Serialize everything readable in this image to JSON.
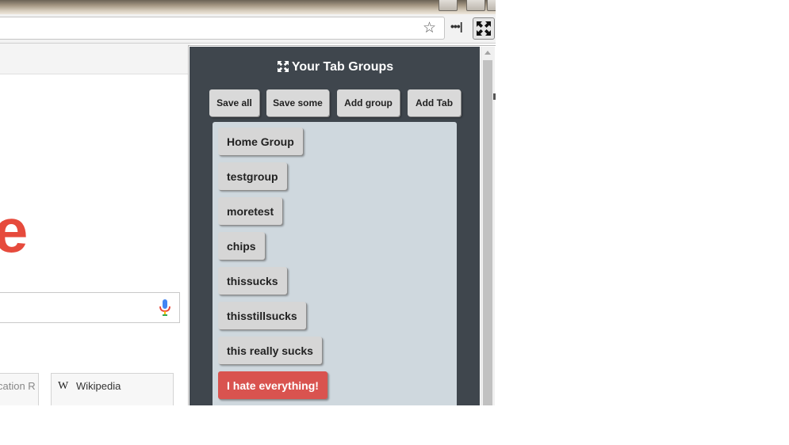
{
  "browser": {
    "toolbar": {
      "star_icon": "star-icon",
      "more_icon": "overflow-menu-icon",
      "more_glyph": "•••|",
      "extension_icon": "expand-arrows-icon"
    }
  },
  "page": {
    "logo_letter": "e",
    "tiles": [
      {
        "label": "cation R"
      },
      {
        "label": "Wikipedia",
        "icon_glyph": "W"
      }
    ]
  },
  "popup": {
    "title": "Your Tab Groups",
    "actions": {
      "save_all": "Save all",
      "save_some": "Save some",
      "add_group": "Add group",
      "add_tab": "Add Tab"
    },
    "groups": [
      {
        "label": "Home Group"
      },
      {
        "label": "testgroup"
      },
      {
        "label": "moretest"
      },
      {
        "label": "chips"
      },
      {
        "label": "thissucks"
      },
      {
        "label": "thisstillsucks"
      },
      {
        "label": "this really sucks"
      },
      {
        "label": "I hate everything!",
        "highlighted": true
      }
    ],
    "colors": {
      "background": "#3f464d",
      "panel": "#cfd8de",
      "button": "#d6d6d6",
      "danger": "#d9534f"
    }
  }
}
